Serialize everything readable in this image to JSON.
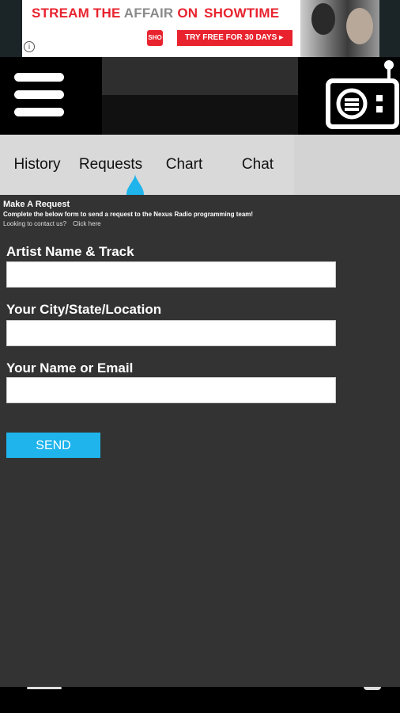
{
  "ad": {
    "headline_part1": "STREAM THE ",
    "headline_part2": "AFFAIR",
    "headline_part3": " ON ",
    "brand": "SHOWTIME",
    "cta": "TRY FREE FOR 30 DAYS ▸",
    "info_icon": "ⓘ",
    "badge": "SHO"
  },
  "header": {
    "menu_icon": "hamburger-menu-icon",
    "radio_icon": "radio-icon"
  },
  "tabs": [
    {
      "label": "History"
    },
    {
      "label": "Requests"
    },
    {
      "label": "Chart"
    },
    {
      "label": "Chat"
    }
  ],
  "active_tab": "Requests",
  "request": {
    "title": "Make A Request",
    "description": "Complete the below form to send a request to the Nexus Radio programming team!",
    "contact_prompt": "Looking to contact us?",
    "contact_link": "Click here"
  },
  "form": {
    "fields": [
      {
        "label": "Artist Name & Track",
        "value": ""
      },
      {
        "label": "Your City/State/Location",
        "value": ""
      },
      {
        "label": "Your Name or Email",
        "value": ""
      }
    ],
    "submit_label": "SEND"
  },
  "colors": {
    "accent": "#1fb4ec",
    "background": "#333333",
    "header": "#000000",
    "ad_red": "#e8232e"
  }
}
